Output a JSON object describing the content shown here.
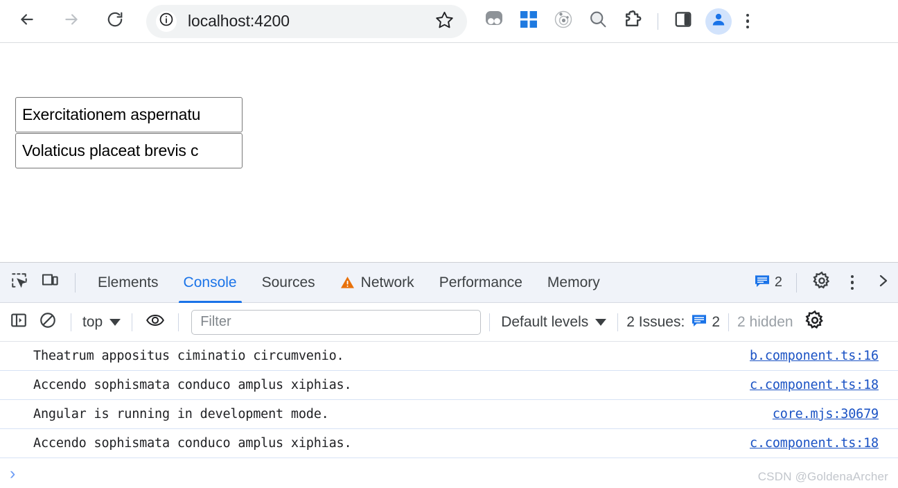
{
  "browser": {
    "back_icon": "arrow-left-icon",
    "forward_icon": "arrow-right-icon",
    "reload_icon": "reload-icon",
    "site_info_icon": "site-info-icon",
    "url": "localhost:4200",
    "bookmark_icon": "star-icon",
    "extensions": [
      {
        "name": "extension-grayscale-icon",
        "color": "#9aa0a6"
      },
      {
        "name": "extension-grid-blue-icon",
        "color": "#1f7ae0"
      },
      {
        "name": "extension-atom-icon",
        "color": "#9aa0a6"
      },
      {
        "name": "extension-search-icon",
        "color": "#6d7278"
      },
      {
        "name": "extensions-puzzle-icon",
        "color": "#3c4043"
      }
    ],
    "side_panel_icon": "side-panel-icon",
    "profile_icon": "profile-avatar-icon",
    "profile_bg": "#d2e3fc",
    "menu_icon": "three-dot-menu-icon"
  },
  "page": {
    "fields": [
      {
        "value": "Exercitationem aspernatu",
        "name": "text-field-1"
      },
      {
        "value": "Volaticus placeat brevis c",
        "name": "text-field-2"
      }
    ]
  },
  "devtools": {
    "inspect_icon": "inspect-element-icon",
    "device_toolbar_icon": "device-toolbar-icon",
    "tabs": [
      {
        "label": "Elements",
        "active": false,
        "warning": false
      },
      {
        "label": "Console",
        "active": true,
        "warning": false
      },
      {
        "label": "Sources",
        "active": false,
        "warning": false
      },
      {
        "label": "Network",
        "active": false,
        "warning": true
      },
      {
        "label": "Performance",
        "active": false,
        "warning": false
      },
      {
        "label": "Memory",
        "active": false,
        "warning": false
      }
    ],
    "active_tab_color": "#1a73e8",
    "warning_color": "#e8710a",
    "issues_badge_count": "2",
    "settings_icon": "gear-icon",
    "more_tools_icon": "three-dot-menu-icon",
    "close_icon": "chevron-right-icon",
    "filterbar": {
      "sidebar_toggle_icon": "console-sidebar-toggle-icon",
      "clear_console_icon": "clear-console-icon",
      "context_label": "top",
      "context_caret_icon": "caret-down-icon",
      "live_expression_icon": "eye-icon",
      "filter_placeholder": "Filter",
      "filter_value": "",
      "levels_label": "Default levels",
      "levels_caret_icon": "caret-down-icon",
      "issues_label": "2 Issues:",
      "issues_count": "2",
      "hidden_label": "2 hidden",
      "settings_icon": "gear-icon"
    },
    "console_rows": [
      {
        "message": "Theatrum appositus ciminatio circumvenio.",
        "source": "b.component.ts:16"
      },
      {
        "message": "Accendo sophismata conduco amplus xiphias.",
        "source": "c.component.ts:18"
      },
      {
        "message": "Angular is running in development mode.",
        "source": "core.mjs:30679"
      },
      {
        "message": "Accendo sophismata conduco amplus xiphias.",
        "source": "c.component.ts:18"
      }
    ],
    "prompt_chevron": "›",
    "link_color": "#1a52c4"
  },
  "watermark": "CSDN @GoldenaArcher"
}
